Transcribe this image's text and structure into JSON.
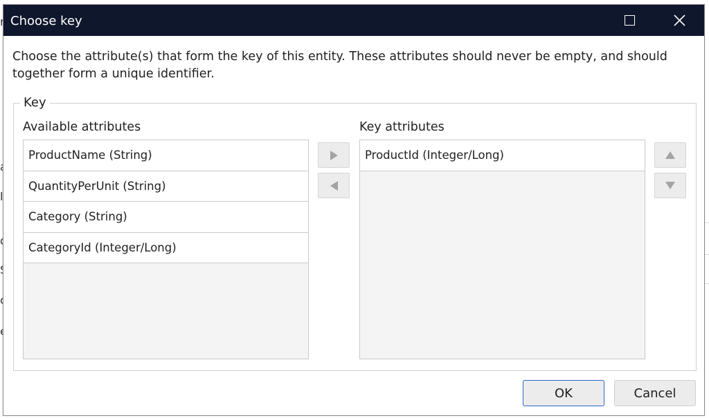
{
  "background_fragments": [
    "r",
    "a",
    "l",
    "d",
    "S",
    "o",
    "e"
  ],
  "dialog": {
    "title": "Choose key",
    "maximize_icon": "maximize-icon",
    "close_icon": "close-icon",
    "description": "Choose the attribute(s) that form the key of this entity. These attributes should never be empty, and should together form a unique identifier.",
    "group_label": "Key",
    "available": {
      "title": "Available attributes",
      "items": [
        "ProductName (String)",
        "QuantityPerUnit (String)",
        "Category (String)",
        "CategoryId (Integer/Long)"
      ]
    },
    "key": {
      "title": "Key attributes",
      "items": [
        "ProductId (Integer/Long)"
      ]
    },
    "buttons": {
      "ok": "OK",
      "cancel": "Cancel"
    },
    "colors": {
      "titlebar": "#0f172d",
      "ok_border": "#2a66c9"
    }
  }
}
